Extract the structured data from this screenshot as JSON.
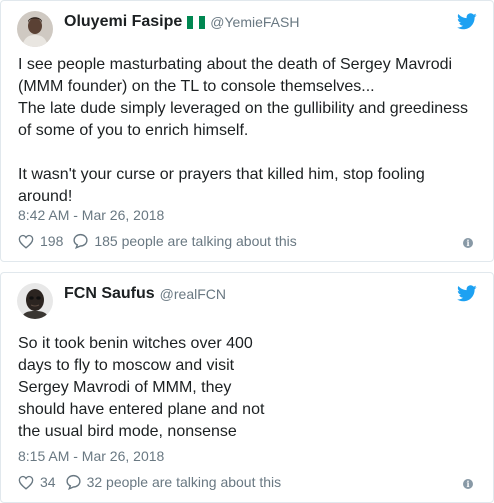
{
  "colors": {
    "twitter_blue": "#1da1f2",
    "text": "#1c2022",
    "meta": "#697882",
    "border": "#e1e8ed",
    "flag_green": "#008751"
  },
  "tweets": [
    {
      "author": {
        "name": "Oluyemi Fasipe",
        "handle": "@YemieFASH",
        "flag": "nigeria-flag"
      },
      "text_lines": [
        "I see people masturbating about the death of Sergey Mavrodi (MMM founder) on the TL to console themselves...",
        "The late dude simply leveraged on the gullibility and greediness of some of you to enrich himself.",
        "",
        "It wasn't your curse or prayers that killed him, stop fooling around!"
      ],
      "timestamp": "8:42 AM - Mar 26, 2018",
      "likes": "198",
      "talking": "185 people are talking about this"
    },
    {
      "author": {
        "name": "FCN Saufus",
        "handle": "@realFCN"
      },
      "text_lines": [
        "So it took benin witches over 400 days to fly to moscow and visit Sergey Mavrodi of MMM, they should have entered plane and not the usual bird mode, nonsense"
      ],
      "timestamp": "8:15 AM - Mar 26, 2018",
      "likes": "34",
      "talking": "32 people are talking about this"
    }
  ],
  "icons": {
    "bird": "twitter-bird-icon",
    "like": "heart-icon",
    "reply": "speech-bubble-icon",
    "info": "info-icon"
  }
}
